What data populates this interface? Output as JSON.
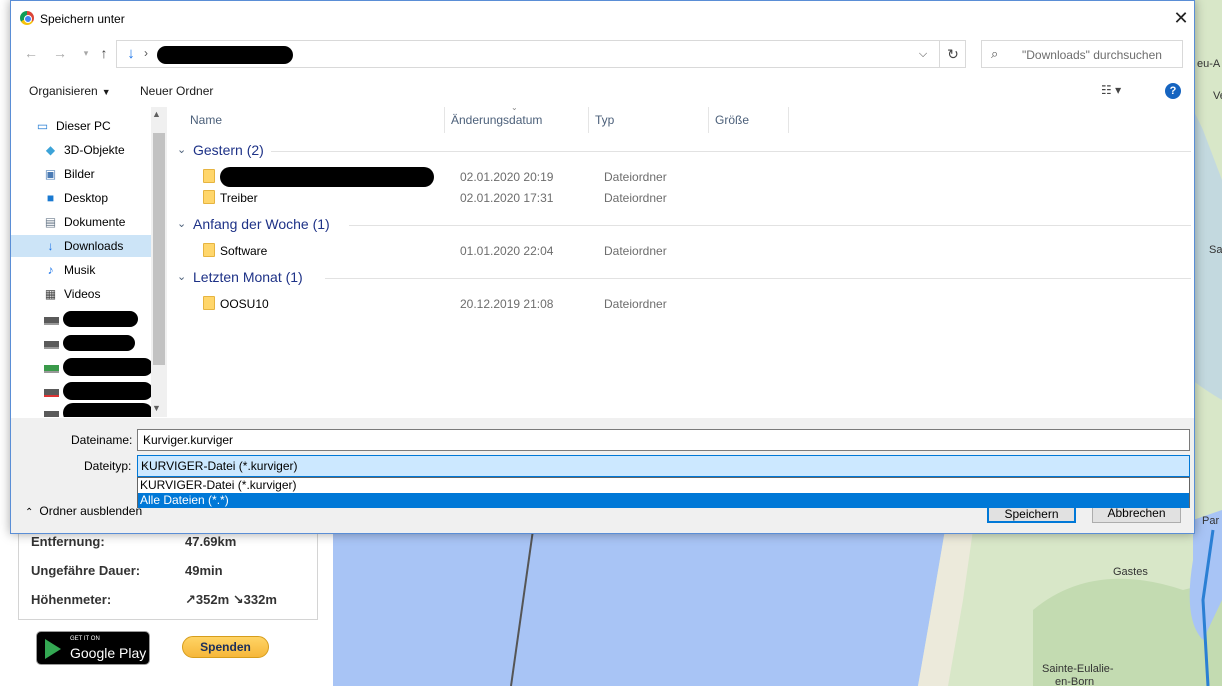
{
  "dialog": {
    "title": "Speichern unter",
    "close_label": "✕",
    "search_placeholder": "\"Downloads\" durchsuchen",
    "toolbar": {
      "organize": "Organisieren",
      "new_folder": "Neuer Ordner"
    },
    "nav_items": [
      {
        "label": "Dieser PC",
        "icon": "computer-icon"
      },
      {
        "label": "3D-Objekte",
        "icon": "cube-icon"
      },
      {
        "label": "Bilder",
        "icon": "pictures-icon"
      },
      {
        "label": "Desktop",
        "icon": "desktop-icon"
      },
      {
        "label": "Dokumente",
        "icon": "document-icon"
      },
      {
        "label": "Downloads",
        "icon": "download-icon",
        "selected": true
      },
      {
        "label": "Musik",
        "icon": "music-icon"
      },
      {
        "label": "Videos",
        "icon": "video-icon"
      }
    ],
    "columns": {
      "name": "Name",
      "date": "Änderungsdatum",
      "type": "Typ",
      "size": "Größe"
    },
    "groups": [
      {
        "label": "Gestern (2)",
        "rows": [
          {
            "name": "",
            "date": "02.01.2020 20:19",
            "type": "Dateiordner"
          },
          {
            "name": "Treiber",
            "date": "02.01.2020 17:31",
            "type": "Dateiordner"
          }
        ]
      },
      {
        "label": "Anfang der Woche (1)",
        "rows": [
          {
            "name": "Software",
            "date": "01.01.2020 22:04",
            "type": "Dateiordner"
          }
        ]
      },
      {
        "label": "Letzten Monat (1)",
        "rows": [
          {
            "name": "OOSU10",
            "date": "20.12.2019 21:08",
            "type": "Dateiordner"
          }
        ]
      }
    ],
    "filename_label": "Dateiname:",
    "filename_value": "Kurviger.kurviger",
    "filetype_label": "Dateityp:",
    "filetype_value": "KURVIGER-Datei (*.kurviger)",
    "filetype_options": [
      "KURVIGER-Datei (*.kurviger)",
      "Alle Dateien (*.*)"
    ],
    "hide_folders": "Ordner ausblenden",
    "save_button": "Speichern",
    "cancel_button": "Abbrechen"
  },
  "background": {
    "stats": [
      {
        "label": "Entfernung:",
        "value": "47.69km"
      },
      {
        "label": "Ungefähre Dauer:",
        "value": "49min"
      },
      {
        "label": "Höhenmeter:",
        "value": "↗352m ↘332m"
      }
    ],
    "gplay_small": "GET IT ON",
    "gplay_big": "Google Play",
    "donate": "Spenden",
    "map_labels": [
      "Gastes",
      "Sainte-Eulalie-",
      "en-Born",
      "Par",
      "Sa",
      "eu-A",
      "Ve"
    ]
  }
}
